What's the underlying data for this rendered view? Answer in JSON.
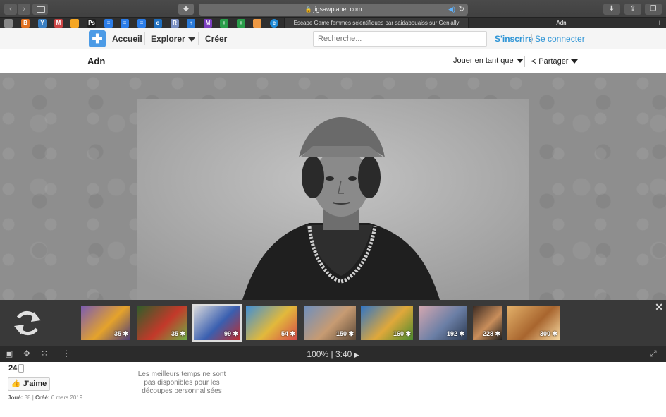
{
  "browser": {
    "url": "jigsawplanet.com",
    "tabs": [
      {
        "label": "Escape Game femmes scientifiques par saidabouaiss sur Genially",
        "active": false
      },
      {
        "label": "Adn",
        "active": true
      }
    ],
    "new_tab_label": "+"
  },
  "site_nav": {
    "home_label": "Accueil",
    "explore_label": "Explorer",
    "create_label": "Créer",
    "search_placeholder": "Recherche...",
    "signup_label": "S'inscrire",
    "login_label": "Se connecter"
  },
  "puzzle": {
    "title": "Adn",
    "play_as_label": "Jouer en tant que",
    "share_label": "Partager"
  },
  "thumbnails": [
    {
      "pieces": "35",
      "colors": [
        "#7a5bb5",
        "#e5a32b",
        "#4c3d7c"
      ]
    },
    {
      "pieces": "35",
      "colors": [
        "#2d5f2a",
        "#c3392a",
        "#6db046"
      ]
    },
    {
      "pieces": "99",
      "colors": [
        "#dcdcdc",
        "#3a5fb0",
        "#c22c2c"
      ],
      "selected": true
    },
    {
      "pieces": "54",
      "colors": [
        "#3d8ed8",
        "#e2b93b",
        "#d44a4a"
      ]
    },
    {
      "pieces": "150",
      "colors": [
        "#6d8fbf",
        "#c79b72",
        "#5d4a39"
      ]
    },
    {
      "pieces": "160",
      "colors": [
        "#2e74c7",
        "#e0a83a",
        "#4a8a2f"
      ]
    },
    {
      "pieces": "192",
      "colors": [
        "#d6a8b0",
        "#6b7fa6",
        "#2c3a52"
      ]
    },
    {
      "pieces": "228",
      "colors": [
        "#3b2a22",
        "#c98e5b",
        "#1d1d1d"
      ]
    },
    {
      "pieces": "300",
      "colors": [
        "#e3b16a",
        "#a8652e",
        "#f5d7a0"
      ]
    }
  ],
  "status": {
    "zoom": "100%",
    "separator": "|",
    "time": "3:40",
    "play_icon": "▶"
  },
  "info": {
    "pieces_count": "24",
    "like_label": "J'aime",
    "played_label": "Joué:",
    "played_value": "38",
    "created_label": "Créé:",
    "created_value": "6 mars 2019",
    "best_times_text": "Les meilleurs temps ne sont pas disponibles pour les découpes personnalisées"
  }
}
